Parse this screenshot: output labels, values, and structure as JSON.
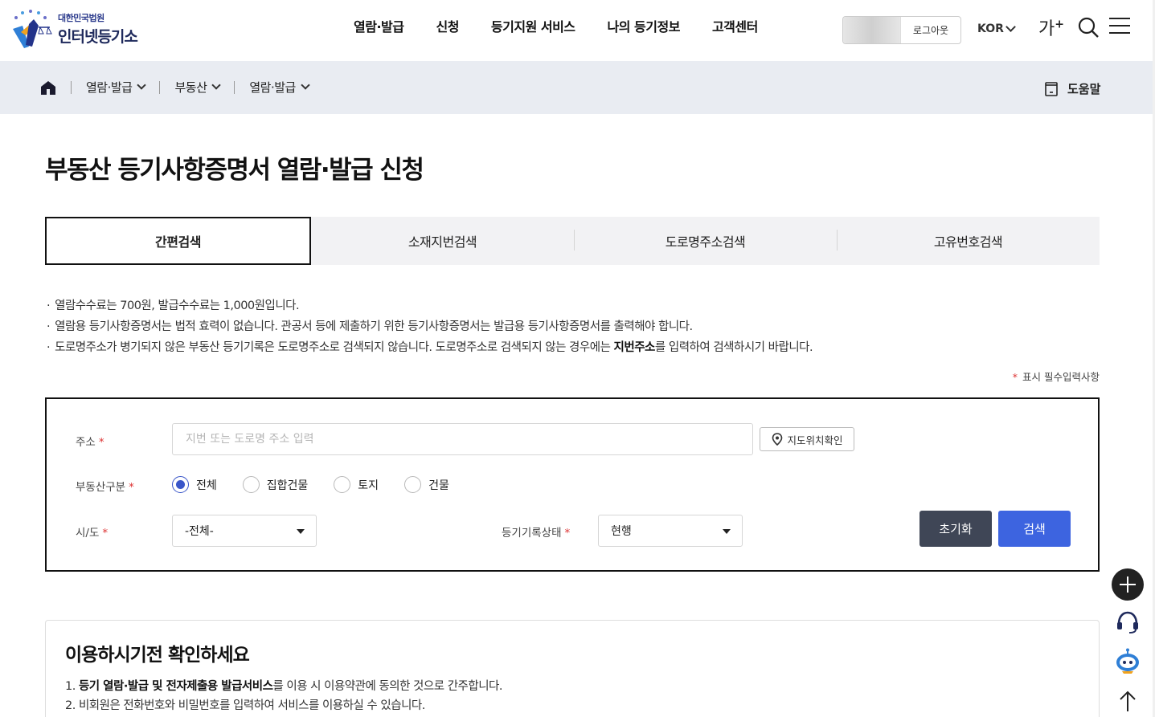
{
  "header": {
    "logo_sub": "대한민국법원",
    "logo_main": "인터넷등기소",
    "nav": [
      "열람·발급",
      "신청",
      "등기지원 서비스",
      "나의 등기정보",
      "고객센터"
    ],
    "logout": "로그아웃",
    "lang": "KOR",
    "font_size_label": "가",
    "font_size_plus": "+"
  },
  "breadcrumb": {
    "items": [
      "열람·발급",
      "부동산",
      "열람·발급"
    ],
    "help": "도움말"
  },
  "page_title": "부동산 등기사항증명서 열람·발급 신청",
  "tabs": [
    {
      "label": "간편검색",
      "active": true
    },
    {
      "label": "소재지번검색",
      "active": false
    },
    {
      "label": "도로명주소검색",
      "active": false
    },
    {
      "label": "고유번호검색",
      "active": false
    }
  ],
  "notices": {
    "line1": "열람수수료는  700원, 발급수수료는  1,000원입니다.",
    "line2": "열람용 등기사항증명서는 법적 효력이 없습니다. 관공서 등에 제출하기 위한 등기사항증명서는 발급용 등기사항증명서를 출력해야 합니다.",
    "line3_a": "도로명주소가 병기되지 않은 부동산 등기기록은 도로명주소로 검색되지 않습니다. 도로명주소로 검색되지 않는 경우에는 ",
    "line3_b": "지번주소",
    "line3_c": "를 입력하여 검색하시기 바랍니다."
  },
  "required_note": "표시 필수입력사항",
  "required_mark": "*",
  "form": {
    "address_label": "주소",
    "address_placeholder": "지번 또는 도로명 주소 입력",
    "address_value": "",
    "map_button": "지도위치확인",
    "type_label": "부동산구분",
    "type_options": [
      "전체",
      "집합건물",
      "토지",
      "건물"
    ],
    "type_selected": "전체",
    "sido_label": "시/도",
    "sido_value": "-전체-",
    "status_label": "등기기록상태",
    "status_value": "현행",
    "reset_button": "초기화",
    "search_button": "검색"
  },
  "info": {
    "title": "이용하시기전 확인하세요",
    "item1_num": "1.",
    "item1_bold": "등기 열람·발급 및 전자제출용 발급서비스",
    "item1_rest": "를 이용 시 이용약관에 동의한 것으로 간주합니다.",
    "item2": "2. 비회원은 전화번호와 비밀번호를 입력하여 서비스를 이용하실 수 있습니다."
  },
  "colors": {
    "primary_blue": "#3d64e0",
    "reset_gray": "#3f4656",
    "crumb_bg": "#e9ecf2",
    "required_red": "#d33333"
  },
  "icons": [
    "home-icon",
    "help-doc-icon",
    "search-icon",
    "menu-icon",
    "map-pin-icon",
    "plus-icon",
    "headset-icon",
    "chatbot-icon",
    "arrow-up-icon"
  ]
}
